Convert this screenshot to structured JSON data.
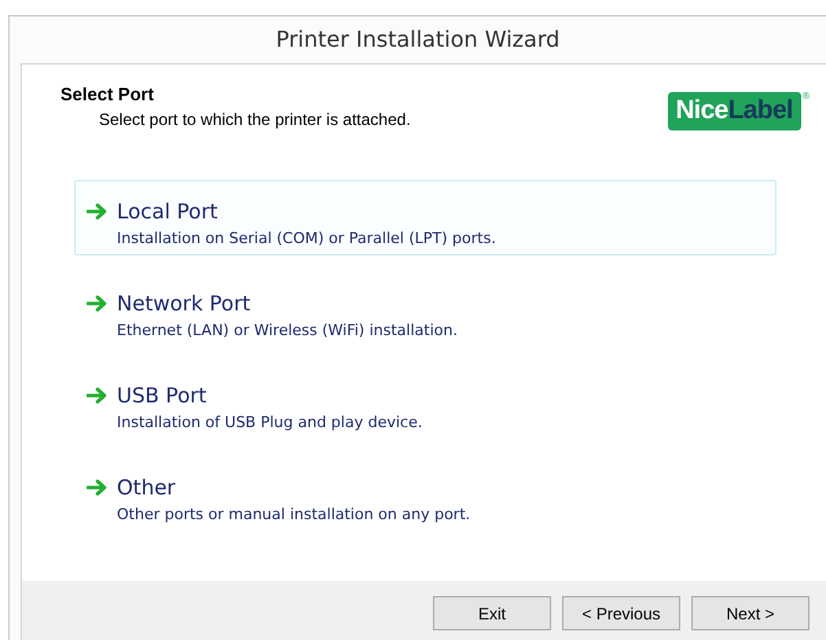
{
  "window": {
    "title": "Printer Installation Wizard"
  },
  "header": {
    "title": "Select Port",
    "subtitle": "Select port to which the printer is attached."
  },
  "logo": {
    "part_1": "Nice",
    "part_2": "Label",
    "mark": "®"
  },
  "options": [
    {
      "title": "Local Port",
      "description": "Installation on Serial (COM) or Parallel (LPT) ports.",
      "selected": true
    },
    {
      "title": "Network Port",
      "description": "Ethernet (LAN) or Wireless (WiFi) installation.",
      "selected": false
    },
    {
      "title": "USB Port",
      "description": "Installation of USB Plug and play device.",
      "selected": false
    },
    {
      "title": "Other",
      "description": "Other ports or manual installation on any port.",
      "selected": false
    }
  ],
  "buttons": [
    "Exit",
    "< Previous",
    "Next >"
  ]
}
